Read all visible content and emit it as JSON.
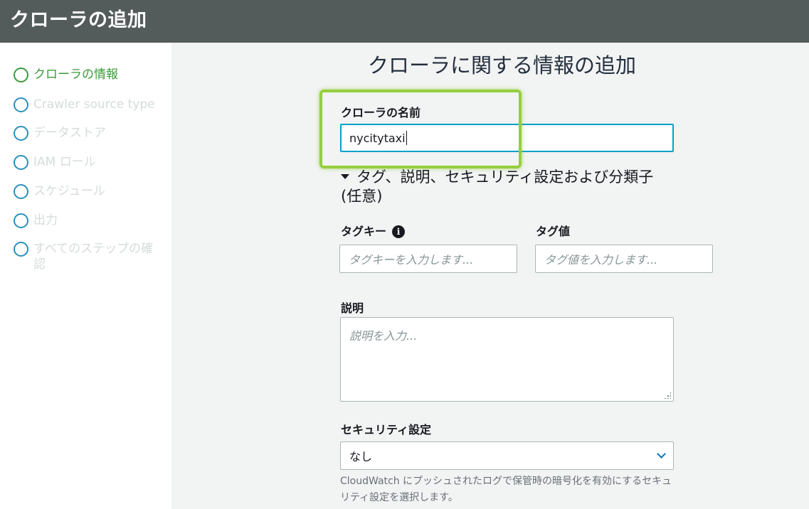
{
  "header": {
    "title": "クローラの追加"
  },
  "sidebar": {
    "steps": [
      {
        "label": "クローラの情報",
        "state": "active"
      },
      {
        "label": "Crawler source type",
        "state": "pending"
      },
      {
        "label": "データストア",
        "state": "pending"
      },
      {
        "label": "IAM ロール",
        "state": "pending"
      },
      {
        "label": "スケジュール",
        "state": "pending"
      },
      {
        "label": "出力",
        "state": "pending"
      },
      {
        "label": "すべてのステップの確認",
        "state": "pending"
      }
    ]
  },
  "main": {
    "title": "クローラに関する情報の追加",
    "crawler_name": {
      "label": "クローラの名前",
      "value": "nycitytaxi"
    },
    "optional_section": {
      "label": "タグ、説明、セキュリティ設定および分類子 (任意)"
    },
    "tag_key": {
      "label": "タグキー",
      "placeholder": "タグキーを入力します..."
    },
    "tag_value": {
      "label": "タグ値",
      "placeholder": "タグ値を入力します..."
    },
    "description": {
      "label": "説明",
      "placeholder": "説明を入力..."
    },
    "security": {
      "label": "セキュリティ設定",
      "selected": "なし",
      "hint": "CloudWatch にプッシュされたログで保管時の暗号化を有効にするセキュリティ設定を選択します。"
    }
  },
  "colors": {
    "header_bg": "#545b5b",
    "active_step": "#3a9b3a",
    "step_circle": "#2a8fbd",
    "highlight_box": "#94cf3f",
    "focus_border": "#00a1c9"
  },
  "icons": {
    "info": "info-icon",
    "toggle": "caret-down-icon",
    "select": "chevron-down-icon"
  }
}
